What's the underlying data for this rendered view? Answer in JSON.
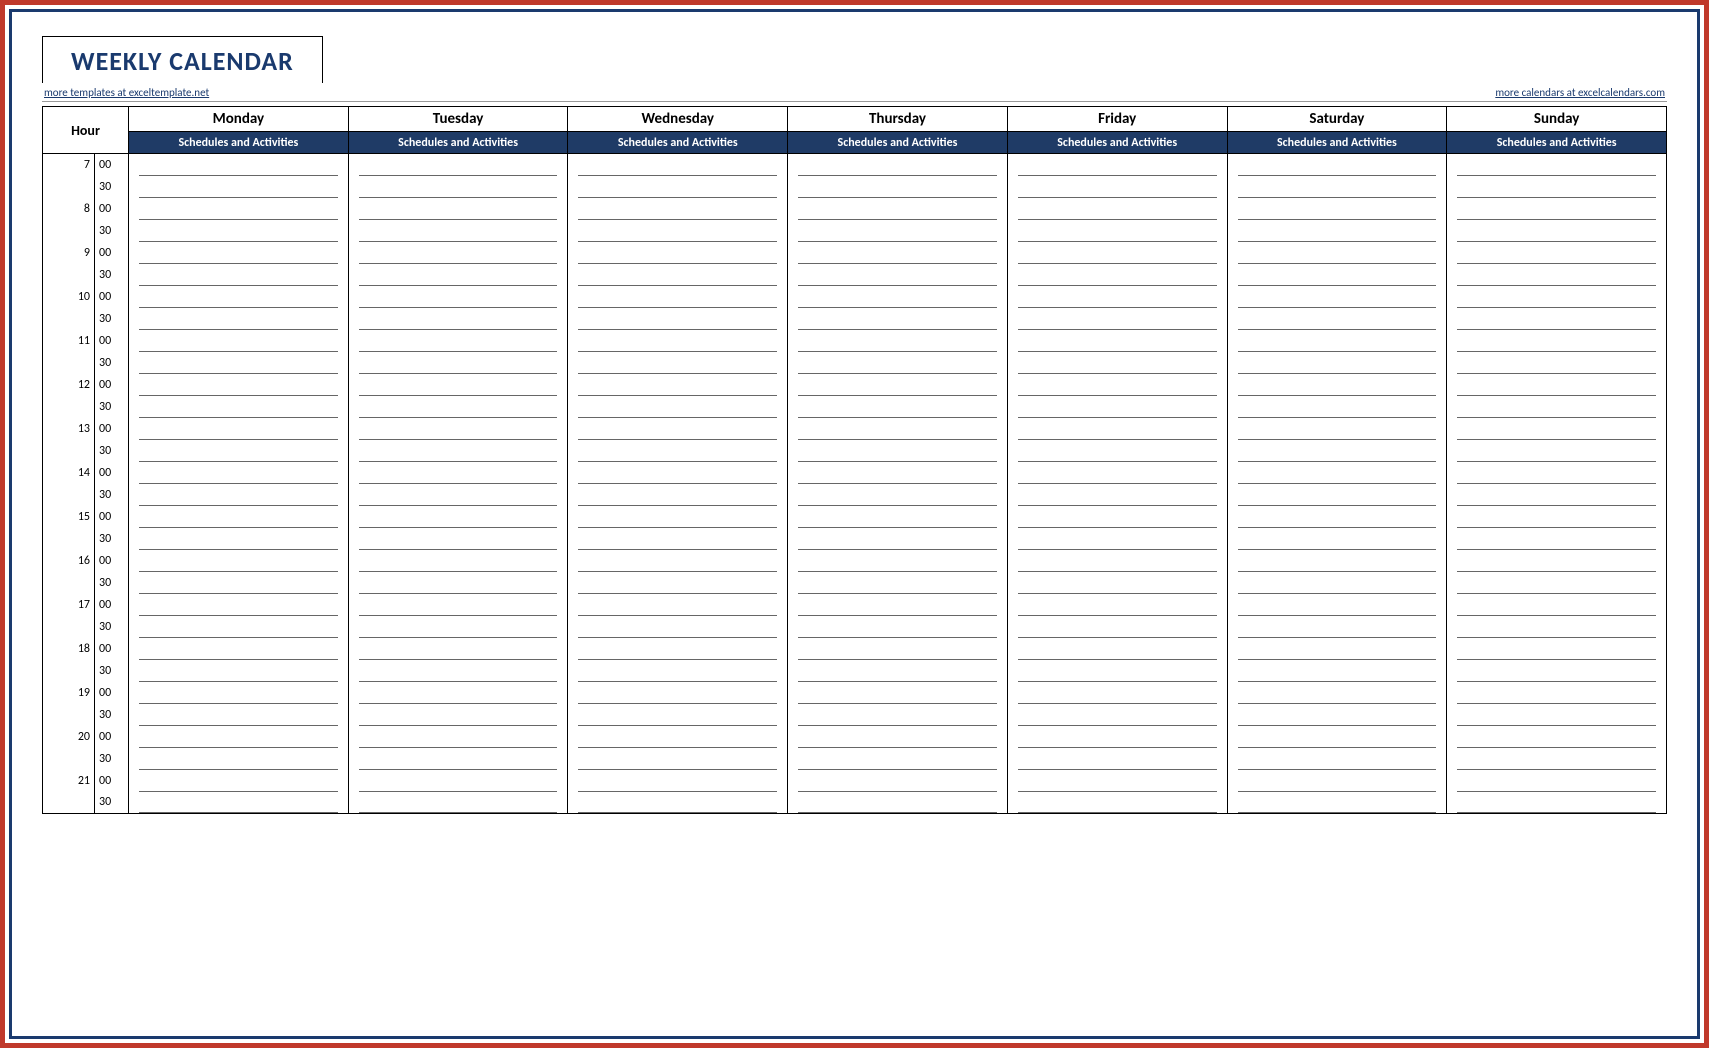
{
  "title": "WEEKLY CALENDAR",
  "link_left": "more templates at exceltemplate.net",
  "link_right": "more calendars at excelcalendars.com",
  "hour_header": "Hour",
  "subheader": "Schedules and Activities",
  "days": [
    "Monday",
    "Tuesday",
    "Wednesday",
    "Thursday",
    "Friday",
    "Saturday",
    "Sunday"
  ],
  "hours": [
    7,
    8,
    9,
    10,
    11,
    12,
    13,
    14,
    15,
    16,
    17,
    18,
    19,
    20,
    21
  ],
  "minute_labels": [
    "00",
    "30"
  ]
}
